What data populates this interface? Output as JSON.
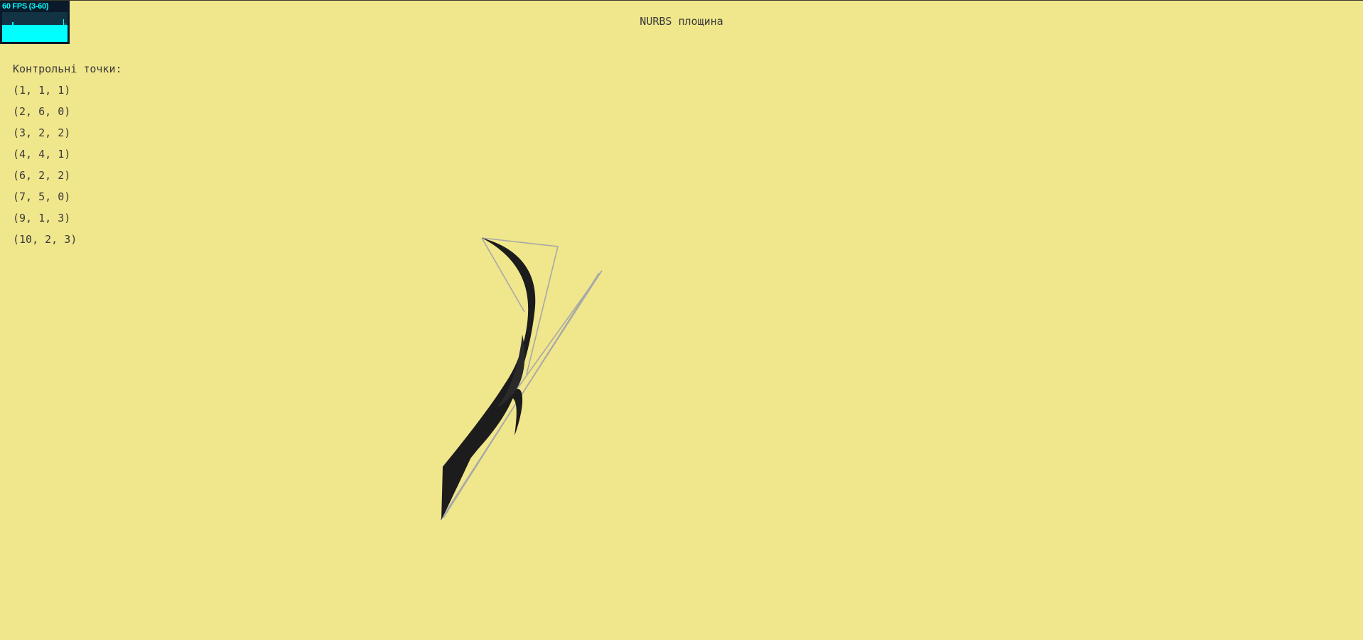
{
  "stats": {
    "label": "60 FPS (3-60)",
    "fps": 60,
    "min": 3,
    "max": 60,
    "fg_color": "#00ffff",
    "bg_color": "#0a1a2a"
  },
  "title": "NURBS площина",
  "control_points": {
    "heading": "Контрольні точки:",
    "items": [
      "(1, 1, 1)",
      "(2, 6, 0)",
      "(3, 2, 2)",
      "(4, 4, 1)",
      "(6, 2, 2)",
      "(7, 5, 0)",
      "(9, 1, 3)",
      "(10, 2, 3)"
    ]
  },
  "colors": {
    "background": "#f0e68c",
    "surface": "#1c1c1c",
    "control_polygon": "#a8a8a8",
    "text": "#3a3a3a"
  }
}
